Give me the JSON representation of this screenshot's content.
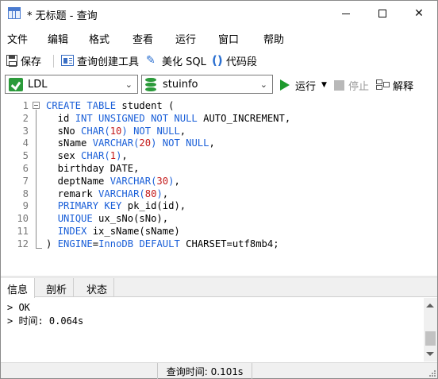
{
  "window": {
    "title": "* 无标题 - 查询",
    "minimize": "minimize",
    "maximize": "maximize",
    "close": "✕"
  },
  "menu": [
    "文件",
    "编辑",
    "格式",
    "查看",
    "运行",
    "窗口",
    "帮助"
  ],
  "toolbar": {
    "save": "保存",
    "query_builder": "查询创建工具",
    "beautify": "美化 SQL",
    "code_snippet": "代码段"
  },
  "selectors": {
    "connection": "LDL",
    "database": "stuinfo",
    "run": "运行",
    "stop": "停止",
    "explain": "解释"
  },
  "editor": {
    "lines": [
      {
        "n": "1",
        "tokens": [
          {
            "t": "CREATE TABLE",
            "c": "kw"
          },
          {
            "t": " student (",
            "c": ""
          }
        ]
      },
      {
        "n": "2",
        "tokens": [
          {
            "t": "  id ",
            "c": ""
          },
          {
            "t": "INT UNSIGNED NOT NULL",
            "c": "kw"
          },
          {
            "t": " AUTO_INCREMENT,",
            "c": ""
          }
        ]
      },
      {
        "n": "3",
        "tokens": [
          {
            "t": "  sNo ",
            "c": ""
          },
          {
            "t": "CHAR(",
            "c": "kw"
          },
          {
            "t": "10",
            "c": "num"
          },
          {
            "t": ")",
            "c": "kw"
          },
          {
            "t": " ",
            "c": ""
          },
          {
            "t": "NOT NULL",
            "c": "kw"
          },
          {
            "t": ",",
            "c": ""
          }
        ]
      },
      {
        "n": "4",
        "tokens": [
          {
            "t": "  sName ",
            "c": ""
          },
          {
            "t": "VARCHAR(",
            "c": "kw"
          },
          {
            "t": "20",
            "c": "num"
          },
          {
            "t": ")",
            "c": "kw"
          },
          {
            "t": " ",
            "c": ""
          },
          {
            "t": "NOT NULL",
            "c": "kw"
          },
          {
            "t": ",",
            "c": ""
          }
        ]
      },
      {
        "n": "5",
        "tokens": [
          {
            "t": "  sex ",
            "c": ""
          },
          {
            "t": "CHAR(",
            "c": "kw"
          },
          {
            "t": "1",
            "c": "num"
          },
          {
            "t": ")",
            "c": "kw"
          },
          {
            "t": ",",
            "c": ""
          }
        ]
      },
      {
        "n": "6",
        "tokens": [
          {
            "t": "  birthday DATE,",
            "c": ""
          }
        ]
      },
      {
        "n": "7",
        "tokens": [
          {
            "t": "  deptName ",
            "c": ""
          },
          {
            "t": "VARCHAR(",
            "c": "kw"
          },
          {
            "t": "30",
            "c": "num"
          },
          {
            "t": ")",
            "c": "kw"
          },
          {
            "t": ",",
            "c": ""
          }
        ]
      },
      {
        "n": "8",
        "tokens": [
          {
            "t": "  remark ",
            "c": ""
          },
          {
            "t": "VARCHAR(",
            "c": "kw"
          },
          {
            "t": "80",
            "c": "num"
          },
          {
            "t": ")",
            "c": "kw"
          },
          {
            "t": ",",
            "c": ""
          }
        ]
      },
      {
        "n": "9",
        "tokens": [
          {
            "t": "  ",
            "c": ""
          },
          {
            "t": "PRIMARY KEY",
            "c": "kw"
          },
          {
            "t": " pk_id(id),",
            "c": ""
          }
        ]
      },
      {
        "n": "10",
        "tokens": [
          {
            "t": "  ",
            "c": ""
          },
          {
            "t": "UNIQUE",
            "c": "kw"
          },
          {
            "t": " ux_sNo(sNo),",
            "c": ""
          }
        ]
      },
      {
        "n": "11",
        "tokens": [
          {
            "t": "  ",
            "c": ""
          },
          {
            "t": "INDEX",
            "c": "kw"
          },
          {
            "t": " ix_sName(sName)",
            "c": ""
          }
        ]
      },
      {
        "n": "12",
        "tokens": [
          {
            "t": ") ",
            "c": ""
          },
          {
            "t": "ENGINE",
            "c": "kw"
          },
          {
            "t": "=",
            "c": ""
          },
          {
            "t": "InnoDB",
            "c": "kw"
          },
          {
            "t": " ",
            "c": ""
          },
          {
            "t": "DEFAULT",
            "c": "kw"
          },
          {
            "t": " CHARSET=utf8mb4;",
            "c": ""
          }
        ]
      }
    ]
  },
  "tabs": [
    "信息",
    "剖析",
    "状态"
  ],
  "output": [
    "> OK",
    "> 时间: 0.064s"
  ],
  "status": {
    "query_time": "查询时间: 0.101s"
  },
  "colors": {
    "keyword": "#1a5fd8",
    "number": "#c41a1a",
    "run_green": "#1d9a2d"
  }
}
